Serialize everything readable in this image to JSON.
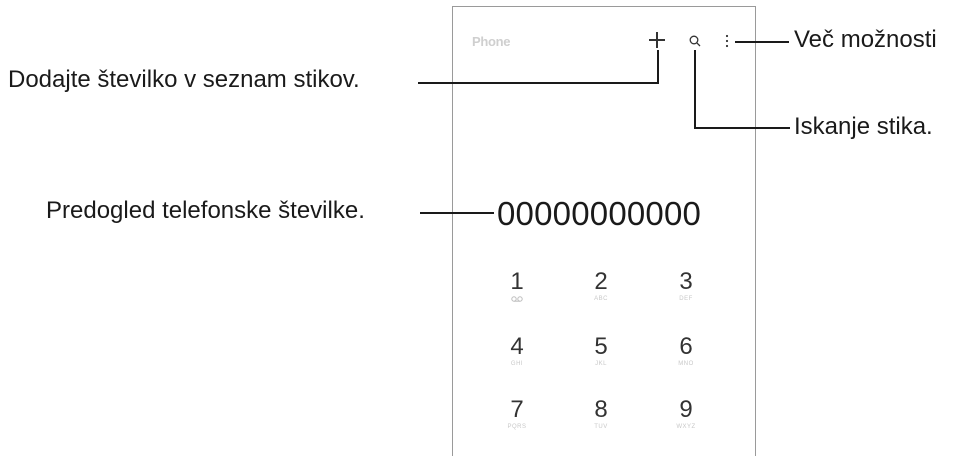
{
  "phone": {
    "app_title": "Phone",
    "preview_number": "00000000000",
    "icons": {
      "add": "plus-icon",
      "search": "search-icon",
      "more": "more-options-icon",
      "voicemail": "voicemail-icon"
    },
    "keypad": [
      {
        "digit": "1",
        "sub": ""
      },
      {
        "digit": "2",
        "sub": "ABC"
      },
      {
        "digit": "3",
        "sub": "DEF"
      },
      {
        "digit": "4",
        "sub": "GHI"
      },
      {
        "digit": "5",
        "sub": "JKL"
      },
      {
        "digit": "6",
        "sub": "MNO"
      },
      {
        "digit": "7",
        "sub": "PQRS"
      },
      {
        "digit": "8",
        "sub": "TUV"
      },
      {
        "digit": "9",
        "sub": "WXYZ"
      }
    ]
  },
  "callouts": {
    "more_options": "Več možnosti",
    "add_contact": "Dodajte številko v seznam stikov.",
    "search_contact": "Iskanje stika.",
    "number_preview": "Predogled telefonske številke."
  }
}
